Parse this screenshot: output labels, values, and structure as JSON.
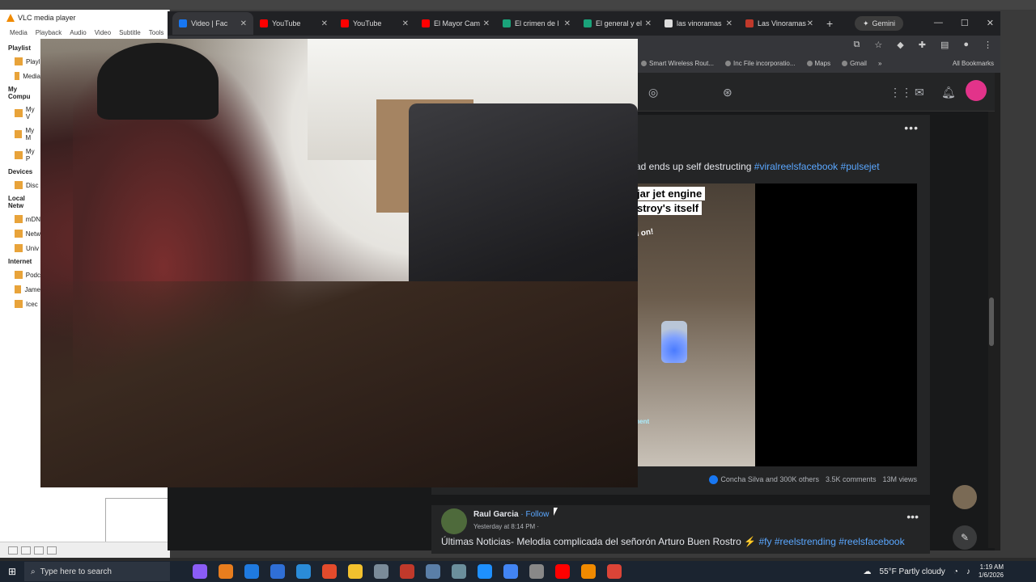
{
  "vlc": {
    "title": "VLC media player",
    "menu": [
      "Media",
      "Playback",
      "Audio",
      "Video",
      "Subtitle",
      "Tools"
    ],
    "sidebar": [
      {
        "type": "hdr",
        "label": "Playlist"
      },
      {
        "type": "item",
        "label": "Playl"
      },
      {
        "type": "item",
        "label": "Media"
      },
      {
        "type": "hdr",
        "label": "My Compu"
      },
      {
        "type": "item",
        "label": "My V"
      },
      {
        "type": "item",
        "label": "My M"
      },
      {
        "type": "item",
        "label": "My P"
      },
      {
        "type": "hdr",
        "label": "Devices"
      },
      {
        "type": "item",
        "label": "Disc"
      },
      {
        "type": "hdr",
        "label": "Local Netw"
      },
      {
        "type": "item",
        "label": "mDN"
      },
      {
        "type": "item",
        "label": "Netw"
      },
      {
        "type": "item",
        "label": "Univ"
      },
      {
        "type": "hdr",
        "label": "Internet"
      },
      {
        "type": "item",
        "label": "Podc"
      },
      {
        "type": "item",
        "label": "Jame"
      },
      {
        "type": "item",
        "label": "Icec"
      }
    ]
  },
  "browser": {
    "tabs": [
      {
        "label": "Video | Fac",
        "color": "#1877f2",
        "active": true
      },
      {
        "label": "YouTube",
        "color": "#ff0000"
      },
      {
        "label": "YouTube",
        "color": "#ff0000"
      },
      {
        "label": "El Mayor Cam",
        "color": "#ff0000"
      },
      {
        "label": "El crimen de l",
        "color": "#1aa37a"
      },
      {
        "label": "El general y el",
        "color": "#1aa37a"
      },
      {
        "label": "las vinoramas",
        "color": "#dddddd"
      },
      {
        "label": "Las Vinoramas",
        "color": "#c0392b"
      }
    ],
    "new_tab": "+",
    "gemini": "Gemini",
    "bookmarks": [
      "Smart Wireless Rout...",
      "Inc File incorporatio...",
      "Maps",
      "Gmail"
    ],
    "all_bookmarks": "All Bookmarks",
    "bookmark_overflow": "»"
  },
  "facebook": {
    "post1": {
      "caption": "ad ends up self destructing",
      "hashtags": [
        "#viralreelsfacebook",
        "#pulsejet"
      ],
      "reel_line1": "jar jet engine",
      "reel_line2": "stroy's itself",
      "reel_small": "d on!",
      "reel_sub": "ment",
      "reactions": "Concha Silva and 300K others",
      "comments": "3.5K comments",
      "views": "13M views"
    },
    "post2": {
      "author": "Raul Garcia",
      "follow": "· Follow",
      "time": "Yesterday at 8:14 PM ·",
      "text": "Últimas Noticias- Melodia complicada del señorón Arturo Buen Rostro ⚡",
      "hashtags": [
        "#fy",
        "#reelstrending",
        "#reelsfacebook"
      ]
    }
  },
  "taskbar": {
    "search_placeholder": "Type here to search",
    "weather": "55°F  Partly cloudy",
    "time": "1:19 AM",
    "date": "1/6/2026",
    "apps": [
      "#8a5cf6",
      "#e87d1e",
      "#1f7ae0",
      "#2f6fd6",
      "#2a8bd8",
      "#e34b2c",
      "#f2c12e",
      "#7a8b99",
      "#c0392b",
      "#5a7fa8",
      "#6b8f9c",
      "#1e90ff",
      "#4285f4",
      "#888888",
      "#ff0000",
      "#f08a00",
      "#db4437"
    ]
  }
}
